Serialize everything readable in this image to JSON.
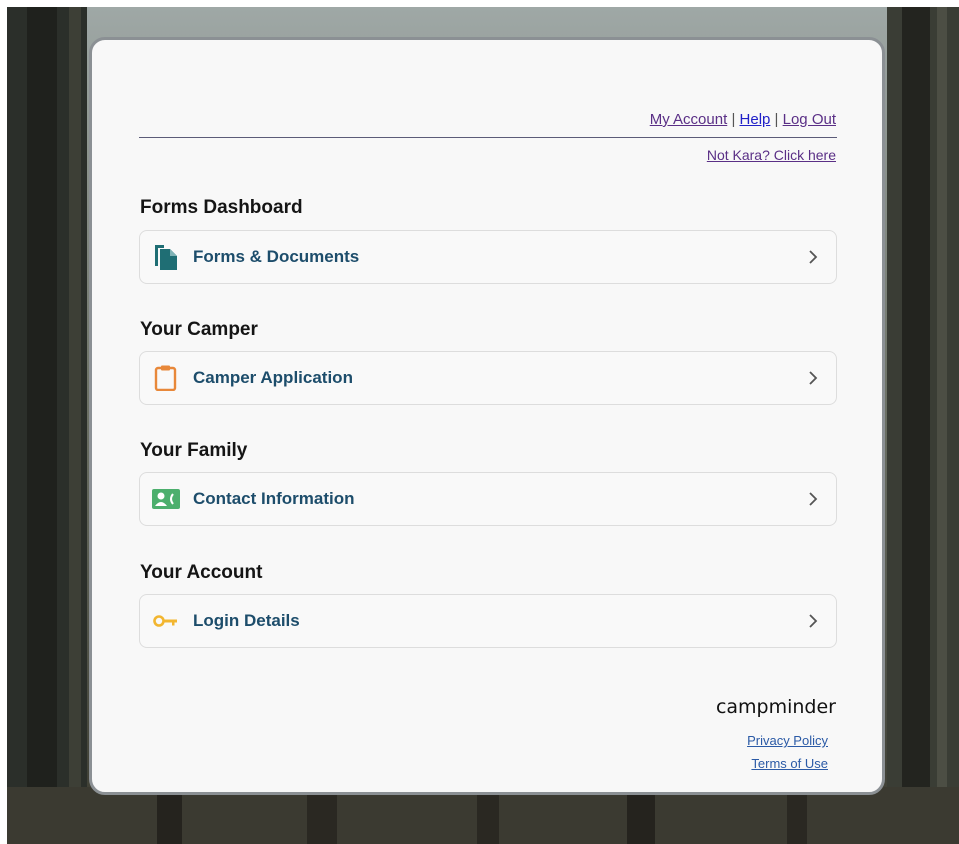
{
  "header": {
    "my_account": "My Account",
    "separator": "|",
    "help": "Help",
    "log_out": "Log Out",
    "not_user": "Not Kara? Click here"
  },
  "sections": [
    {
      "title": "Forms Dashboard",
      "item": {
        "label": "Forms & Documents",
        "icon": "document-icon",
        "icon_color": "#1f6e74"
      }
    },
    {
      "title": "Your Camper",
      "item": {
        "label": "Camper Application",
        "icon": "clipboard-icon",
        "icon_color": "#e8883a"
      }
    },
    {
      "title": "Your Family",
      "item": {
        "label": "Contact Information",
        "icon": "contact-card-icon",
        "icon_color": "#4caf6d"
      }
    },
    {
      "title": "Your Account",
      "item": {
        "label": "Login Details",
        "icon": "key-icon",
        "icon_color": "#f2b630"
      }
    }
  ],
  "footer": {
    "brand": "campminder",
    "privacy": "Privacy Policy",
    "terms": "Terms of Use"
  },
  "colors": {
    "label_text": "#1d4d6b",
    "link_purple": "#5a2f86",
    "link_blue": "#2020c8"
  }
}
